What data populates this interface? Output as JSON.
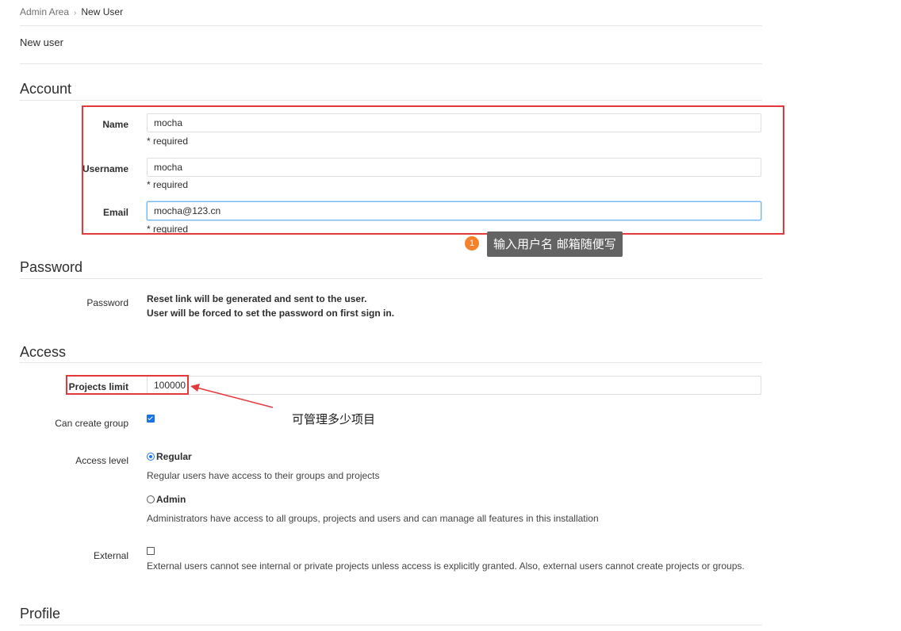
{
  "breadcrumb": {
    "root": "Admin Area",
    "current": "New User"
  },
  "page_title": "New user",
  "sections": {
    "account": "Account",
    "password": "Password",
    "access": "Access",
    "profile": "Profile"
  },
  "account": {
    "name": {
      "label": "Name",
      "value": "mocha",
      "help": "* required"
    },
    "username": {
      "label": "Username",
      "value": "mocha",
      "help": "* required"
    },
    "email": {
      "label": "Email",
      "value": "mocha@123.cn",
      "help": "* required"
    }
  },
  "annotation_1": {
    "badge": "1",
    "text": "输入用户名 邮箱随便写"
  },
  "password": {
    "label": "Password",
    "line1": "Reset link will be generated and sent to the user.",
    "line2": "User will be forced to set the password on first sign in."
  },
  "access": {
    "projects_limit": {
      "label": "Projects limit",
      "value": "100000"
    },
    "projects_limit_note": "可管理多少项目",
    "can_create_group": {
      "label": "Can create group",
      "checked": true
    },
    "access_level": {
      "label": "Access level",
      "regular": {
        "label": "Regular",
        "help": "Regular users have access to their groups and projects",
        "selected": true
      },
      "admin": {
        "label": "Admin",
        "help": "Administrators have access to all groups, projects and users and can manage all features in this installation",
        "selected": false
      }
    },
    "external": {
      "label": "External",
      "checked": false,
      "help": "External users cannot see internal or private projects unless access is explicitly granted. Also, external users cannot create projects or groups."
    }
  },
  "colors": {
    "annotation_red": "#e4393c",
    "badge_orange": "#f5822a",
    "bubble_gray": "#636363",
    "focus_blue": "#73b9f5",
    "control_blue": "#1a73e8"
  }
}
